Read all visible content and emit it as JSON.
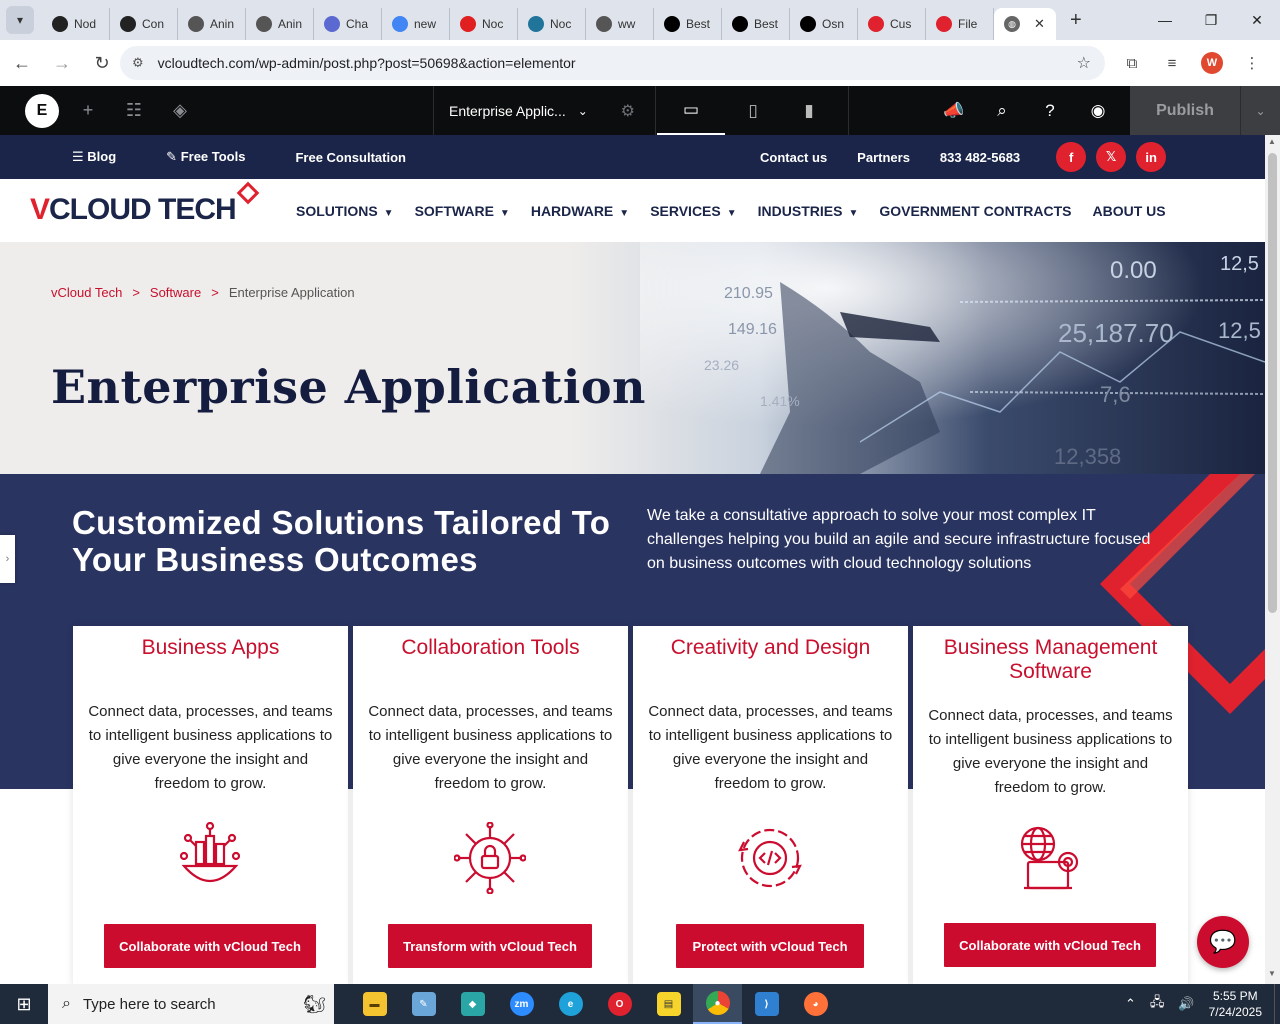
{
  "browser": {
    "tabs": [
      {
        "label": "Nod",
        "color": "#222"
      },
      {
        "label": "Con",
        "color": "#222"
      },
      {
        "label": "Anin",
        "color": "#555"
      },
      {
        "label": "Anin",
        "color": "#555"
      },
      {
        "label": "Cha",
        "color": "#5b6ad0"
      },
      {
        "label": "new",
        "color": "#4285f4"
      },
      {
        "label": "Noc",
        "color": "#e02020"
      },
      {
        "label": "Noc",
        "color": "#21759b"
      },
      {
        "label": "ww",
        "color": "#555"
      },
      {
        "label": "Best",
        "color": "#000"
      },
      {
        "label": "Best",
        "color": "#000"
      },
      {
        "label": "Osn",
        "color": "#000"
      },
      {
        "label": "Cus",
        "color": "#e0222f"
      },
      {
        "label": "File",
        "color": "#e0222f"
      }
    ],
    "active_tab_icon": "globe-icon",
    "close_glyph": "✕",
    "new_tab_glyph": "+",
    "url": "vcloudtech.com/wp-admin/post.php?post=50698&action=elementor",
    "profile_initial": "W"
  },
  "elementor": {
    "logo_glyph": "E",
    "document_title": "Enterprise Applic...",
    "publish_label": "Publish"
  },
  "site": {
    "topbar": {
      "blog": "Blog",
      "free_tools": "Free Tools",
      "free_consultation": "Free Consultation",
      "contact": "Contact us",
      "partners": "Partners",
      "phone": "833 482-5683"
    },
    "logo_text_v": "V",
    "logo_text_rest": "CLOUD TECH",
    "nav": [
      {
        "label": "SOLUTIONS",
        "caret": "▼"
      },
      {
        "label": "SOFTWARE",
        "caret": "▼"
      },
      {
        "label": "HARDWARE",
        "caret": "▼"
      },
      {
        "label": "SERVICES",
        "caret": "▼"
      },
      {
        "label": "INDUSTRIES",
        "caret": "▼"
      },
      {
        "label": "GOVERNMENT CONTRACTS",
        "caret": ""
      },
      {
        "label": "ABOUT US",
        "caret": ""
      }
    ],
    "breadcrumb": {
      "home": "vCloud Tech",
      "sep": ">",
      "section": "Software",
      "current": "Enterprise Application"
    },
    "hero_title": "Enterprise Application",
    "hero_numbers": [
      "0.00",
      "210.95",
      "149.16",
      "23.26",
      "1.41%",
      "25,187.70",
      "12,5",
      "7,6",
      "12,358"
    ],
    "solutions_heading": "Customized Solutions Tailored To Your Business Outcomes",
    "solutions_text": "We take a consultative approach to solve your most complex IT challenges helping you build an agile and secure infrastructure focused on business outcomes with cloud technology solutions",
    "cards": [
      {
        "title": "Business Apps",
        "body": "Connect data, processes, and teams to intelligent business applications to give everyone the insight and freedom to grow.",
        "cta": "Collaborate with vCloud Tech",
        "icon": "business-apps-icon"
      },
      {
        "title": "Collaboration Tools",
        "body": "Connect data, processes, and teams to intelligent business applications to give everyone the insight and freedom to grow.",
        "cta": "Transform with vCloud Tech",
        "icon": "collaboration-lock-icon"
      },
      {
        "title": "Creativity and Design",
        "body": "Connect data, processes, and teams to intelligent business applications to give everyone the insight and freedom to grow.",
        "cta": "Protect with vCloud Tech",
        "icon": "code-gear-icon"
      },
      {
        "title": "Business Management Software",
        "body": "Connect data, processes, and teams to intelligent business applications to give everyone the insight and freedom to grow.",
        "cta": "Collaborate with vCloud Tech",
        "icon": "globe-gear-icon"
      }
    ],
    "brand_red": "#cc0c2f",
    "brand_navy": "#1b2549"
  },
  "taskbar": {
    "search_placeholder": "Type here to search",
    "time": "5:55 PM",
    "date": "7/24/2025"
  }
}
